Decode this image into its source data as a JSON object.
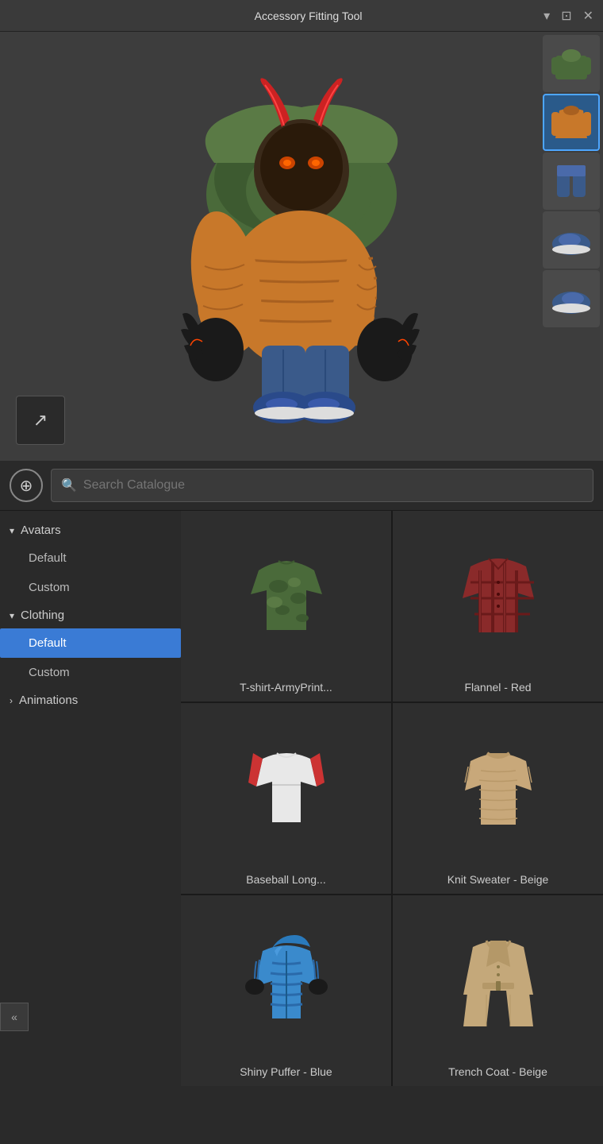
{
  "titleBar": {
    "title": "Accessory Fitting Tool",
    "controls": [
      "▾",
      "⊡",
      "✕"
    ]
  },
  "externalLinkBtn": {
    "icon": "↗"
  },
  "addBtn": {
    "icon": "⊕"
  },
  "search": {
    "placeholder": "Search Catalogue"
  },
  "sidebar": {
    "sections": [
      {
        "id": "avatars",
        "label": "Avatars",
        "expanded": true,
        "items": [
          {
            "id": "avatars-default",
            "label": "Default",
            "active": false
          },
          {
            "id": "avatars-custom",
            "label": "Custom",
            "active": false
          }
        ]
      },
      {
        "id": "clothing",
        "label": "Clothing",
        "expanded": true,
        "items": [
          {
            "id": "clothing-default",
            "label": "Default",
            "active": true
          },
          {
            "id": "clothing-custom",
            "label": "Custom",
            "active": false
          }
        ]
      },
      {
        "id": "animations",
        "label": "Animations",
        "expanded": false,
        "items": []
      }
    ]
  },
  "catalogue": {
    "items": [
      {
        "id": "tshirt-army",
        "label": "T-shirt-ArmyPrint...",
        "color": "#4a6a3a"
      },
      {
        "id": "flannel-red",
        "label": "Flannel - Red",
        "color": "#8a2a2a"
      },
      {
        "id": "baseball-long",
        "label": "Baseball Long...",
        "color": "#cc3333"
      },
      {
        "id": "knit-sweater-beige",
        "label": "Knit Sweater - Beige",
        "color": "#c8a87a"
      },
      {
        "id": "shiny-puffer-blue",
        "label": "Shiny Puffer - Blue",
        "color": "#3a8acc"
      },
      {
        "id": "trench-coat-beige",
        "label": "Trench Coat - Beige",
        "color": "#c4a87a"
      }
    ]
  },
  "accessorySidebar": {
    "items": [
      {
        "id": "acc-1",
        "active": false,
        "color": "#5a6a3a"
      },
      {
        "id": "acc-2",
        "active": true,
        "color": "#c8782a"
      },
      {
        "id": "acc-3",
        "active": false,
        "color": "#444a60"
      },
      {
        "id": "acc-4",
        "active": false,
        "color": "#555a70"
      },
      {
        "id": "acc-5",
        "active": false,
        "color": "#444a60"
      }
    ]
  },
  "collapseBtn": {
    "icon": "«"
  }
}
